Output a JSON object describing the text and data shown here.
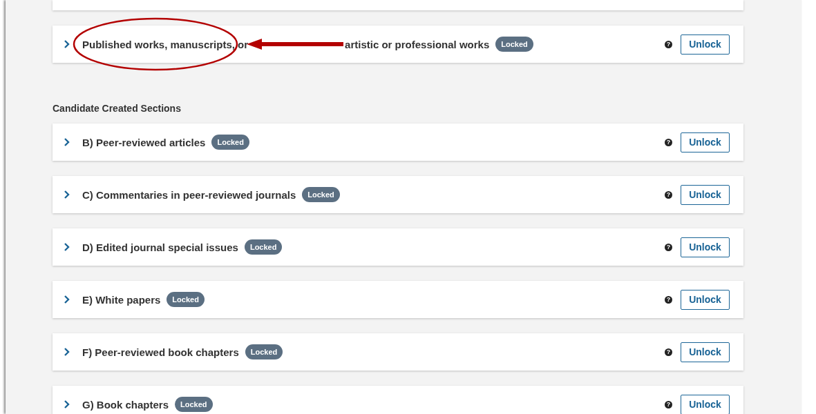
{
  "sections_top": [
    {
      "kind": "annotated",
      "title": "Published works, manuscripts, or",
      "title_after_arrow": "artistic or professional works",
      "badge": "Locked",
      "help": "?",
      "button": "Unlock"
    }
  ],
  "candidate_heading": "Candidate Created Sections",
  "candidate_sections": [
    {
      "kind": "plain",
      "title": "B) Peer-reviewed articles",
      "badge": "Locked",
      "help": "?",
      "button": "Unlock"
    },
    {
      "kind": "plain",
      "title": "C) Commentaries in peer-reviewed journals",
      "badge": "Locked",
      "help": "?",
      "button": "Unlock"
    },
    {
      "kind": "plain",
      "title": "D) Edited journal special issues",
      "badge": "Locked",
      "help": "?",
      "button": "Unlock"
    },
    {
      "kind": "plain",
      "title": "E) White papers",
      "badge": "Locked",
      "help": "?",
      "button": "Unlock"
    },
    {
      "kind": "plain",
      "title": "F) Peer-reviewed book chapters",
      "badge": "Locked",
      "help": "?",
      "button": "Unlock"
    },
    {
      "kind": "plain",
      "title": "G) Book chapters",
      "badge": "Locked",
      "help": "?",
      "button": "Unlock"
    }
  ]
}
